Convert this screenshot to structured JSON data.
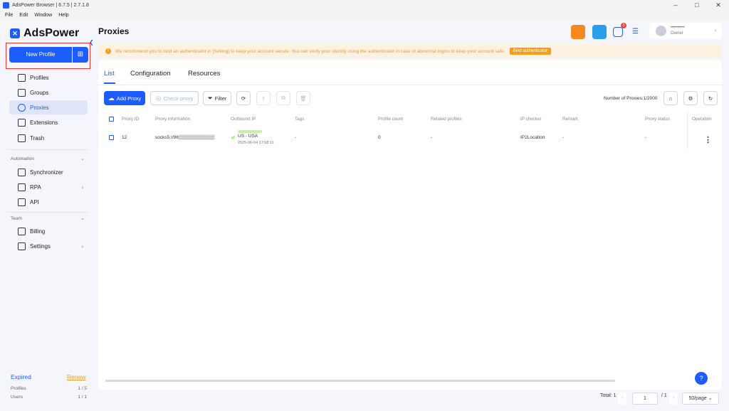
{
  "window": {
    "title": "AdsPower Browser | 6.7.5 | 2.7.1.8",
    "minimize": "–",
    "maximize": "□",
    "close": "✕"
  },
  "menu": [
    "File",
    "Edit",
    "Window",
    "Help"
  ],
  "sidebar": {
    "logo": "AdsPower",
    "new_profile": "New Profile",
    "items": [
      {
        "label": "Profiles"
      },
      {
        "label": "Groups"
      },
      {
        "label": "Proxies"
      },
      {
        "label": "Extensions"
      },
      {
        "label": "Trash"
      }
    ],
    "automation_label": "Automation",
    "automation_items": [
      {
        "label": "Synchronizer"
      },
      {
        "label": "RPA"
      },
      {
        "label": "API"
      }
    ],
    "team_label": "Team",
    "team_items": [
      {
        "label": "Billing"
      },
      {
        "label": "Settings"
      }
    ],
    "expired": "Expired",
    "renew": "Renew",
    "profiles_label": "Profiles",
    "profiles_value": "1 / 5",
    "users_label": "Users",
    "users_value": "1 / 1"
  },
  "header": {
    "title": "Proxies",
    "notif_count": "3",
    "account_name": "••••••••••••",
    "account_role": "Owner"
  },
  "alert": {
    "text": "We recommend you to bind an authenticator in [Setting] to keep your account secure. You can verify your identity using the authenticator in case of abnormal logins to keep your account safe.",
    "button": "Bind authenticator"
  },
  "tabs": [
    "List",
    "Configuration",
    "Resources"
  ],
  "toolbar": {
    "add_proxy": "Add Proxy",
    "check_proxy": "Check proxy",
    "filter": "Filter",
    "count": "Number of Proxies:1/2000"
  },
  "table": {
    "headers": [
      "Proxy ID",
      "Proxy information",
      "Outbound IP",
      "Tags",
      "Profile count",
      "Related profiles",
      "IP checker",
      "Remark",
      "Proxy status",
      "Operation"
    ],
    "rows": [
      {
        "id": "12",
        "info": "socks5://96▒▒▒▒▒▒▒▒▒▒▒",
        "country": "US - USA",
        "date": "2025-06-04 17:08:11",
        "tags": "-",
        "profile_count": "0",
        "related": "-",
        "checker": "IP2Location",
        "remark": "-",
        "status": "-"
      }
    ]
  },
  "pagination": {
    "total": "Total: 1",
    "page": "1",
    "of": "/ 1",
    "per_page": "50/page"
  },
  "colors": {
    "accent": "#1d5cff",
    "warning": "#f0a020",
    "danger": "#e33333"
  }
}
